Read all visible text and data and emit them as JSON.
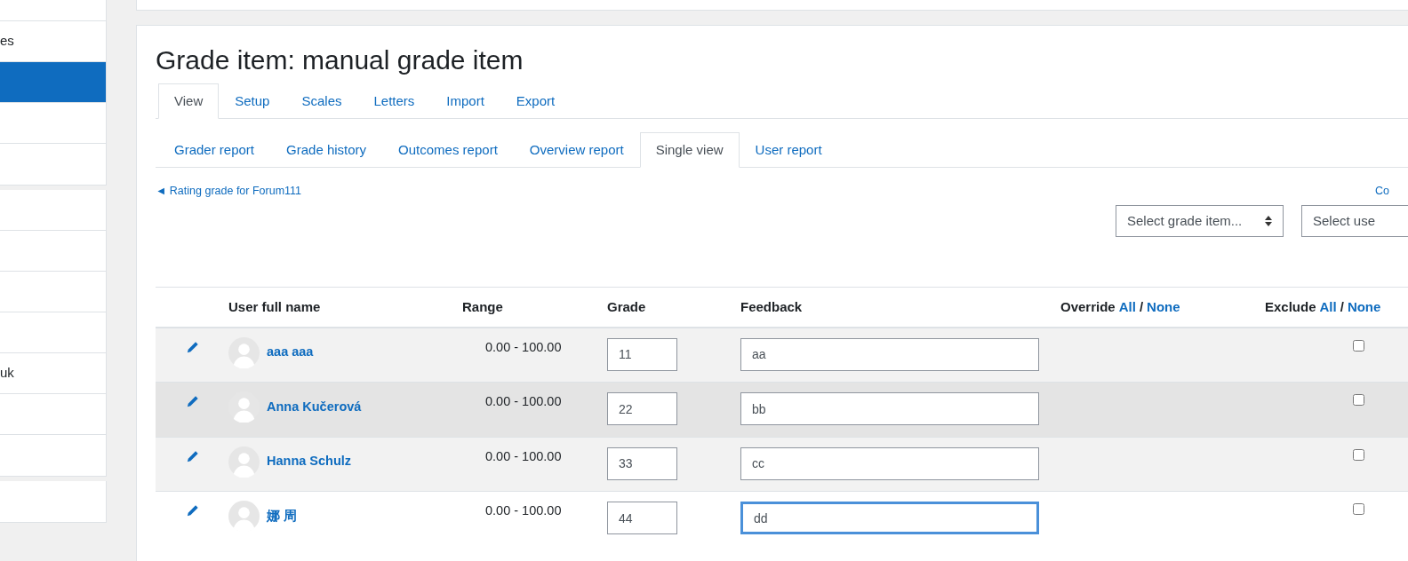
{
  "sidebar": {
    "groups": [
      {
        "items": [
          {
            "selected": false
          },
          {
            "label": "es",
            "selected": false
          },
          {
            "selected": true
          },
          {
            "selected": false
          },
          {
            "selected": false
          }
        ]
      },
      {
        "items": [
          {
            "selected": false
          },
          {
            "selected": false
          },
          {
            "selected": false
          },
          {
            "selected": false
          },
          {
            "label": "uk",
            "selected": false
          },
          {
            "selected": false
          },
          {
            "selected": false
          }
        ]
      },
      {
        "items": [
          {
            "selected": false
          }
        ]
      }
    ]
  },
  "page_title": "Grade item: manual grade item",
  "tabs": [
    {
      "label": "View",
      "selected": true
    },
    {
      "label": "Setup",
      "selected": false
    },
    {
      "label": "Scales",
      "selected": false
    },
    {
      "label": "Letters",
      "selected": false
    },
    {
      "label": "Import",
      "selected": false
    },
    {
      "label": "Export",
      "selected": false
    }
  ],
  "subtabs": [
    {
      "label": "Grader report",
      "selected": false
    },
    {
      "label": "Grade history",
      "selected": false
    },
    {
      "label": "Outcomes report",
      "selected": false
    },
    {
      "label": "Overview report",
      "selected": false
    },
    {
      "label": "Single view",
      "selected": true
    },
    {
      "label": "User report",
      "selected": false
    }
  ],
  "prev_link": "◄ Rating grade for Forum111",
  "next_link": "Co",
  "selects": [
    {
      "value": "Select grade item..."
    },
    {
      "value": "Select use"
    }
  ],
  "table": {
    "columns": {
      "name": "User full name",
      "range": "Range",
      "grade": "Grade",
      "feedback": "Feedback",
      "override": {
        "label": "Override",
        "all": "All",
        "separator": "/",
        "none": "None"
      },
      "exclude": {
        "label": "Exclude",
        "all": "All",
        "separator": "/",
        "none": "None"
      }
    },
    "rows": [
      {
        "name": "aaa aaa",
        "range": "0.00 - 100.00",
        "grade": "11",
        "feedback": "aa",
        "hovered": false,
        "focused": false,
        "excluded": false
      },
      {
        "name": "Anna Kučerová",
        "range": "0.00 - 100.00",
        "grade": "22",
        "feedback": "bb",
        "hovered": true,
        "focused": false,
        "excluded": false
      },
      {
        "name": "Hanna Schulz",
        "range": "0.00 - 100.00",
        "grade": "33",
        "feedback": "cc",
        "hovered": false,
        "focused": false,
        "excluded": false
      },
      {
        "name": "娜 周",
        "range": "0.00 - 100.00",
        "grade": "44",
        "feedback": "dd",
        "hovered": false,
        "focused": true,
        "excluded": false
      }
    ]
  }
}
